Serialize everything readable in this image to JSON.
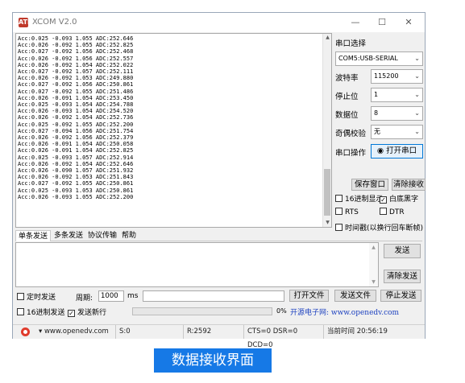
{
  "window": {
    "title": "XCOM V2.0",
    "app_icon": "ATK",
    "minimize": "—",
    "maximize": "☐",
    "close": "✕"
  },
  "receive": {
    "lines": [
      "Acc:0.025 -0.093 1.055 ADC:252.646",
      "Acc:0.026 -0.092 1.055 ADC:252.825",
      "Acc:0.027 -0.092 1.056 ADC:252.468",
      "Acc:0.026 -0.092 1.056 ADC:252.557",
      "Acc:0.026 -0.092 1.054 ADC:252.022",
      "Acc:0.027 -0.092 1.057 ADC:252.111",
      "Acc:0.026 -0.092 1.053 ADC:249.880",
      "Acc:0.027 -0.092 1.056 ADC:250.861",
      "Acc:0.027 -0.092 1.055 ADC:251.486",
      "Acc:0.026 -0.091 1.054 ADC:253.450",
      "Acc:0.025 -0.093 1.054 ADC:254.788",
      "Acc:0.026 -0.093 1.054 ADC:254.520",
      "Acc:0.026 -0.092 1.054 ADC:252.736",
      "Acc:0.025 -0.092 1.055 ADC:252.200",
      "Acc:0.027 -0.094 1.056 ADC:251.754",
      "Acc:0.026 -0.092 1.056 ADC:252.379",
      "Acc:0.026 -0.091 1.054 ADC:250.058",
      "Acc:0.026 -0.091 1.054 ADC:252.825",
      "Acc:0.025 -0.093 1.057 ADC:252.914",
      "Acc:0.026 -0.092 1.054 ADC:252.646",
      "Acc:0.026 -0.090 1.057 ADC:251.932",
      "Acc:0.026 -0.092 1.053 ADC:251.843",
      "Acc:0.027 -0.092 1.055 ADC:250.861",
      "Acc:0.025 -0.093 1.053 ADC:250.861",
      "Acc:0.026 -0.093 1.055 ADC:252.200"
    ],
    "scroll_up": "▲",
    "scroll_down": "▼"
  },
  "settings": {
    "port_label": "串口选择",
    "port_value": "COM5:USB-SERIAL",
    "baud_label": "波特率",
    "baud_value": "115200",
    "stop_label": "停止位",
    "stop_value": "1",
    "data_label": "数据位",
    "data_value": "8",
    "parity_label": "奇偶校验",
    "parity_value": "无",
    "op_label": "串口操作",
    "open_button": "打开串口",
    "save_window": "保存窗口",
    "clear_receive": "清除接收",
    "hex_display": "16进制显示",
    "white_bg": "白底黑字",
    "rts": "RTS",
    "dtr": "DTR",
    "timestamp": "时间戳(以换行回车断帧)"
  },
  "tabs": [
    "单条发送",
    "多条发送",
    "协议传输",
    "帮助"
  ],
  "send": {
    "send_button": "发送",
    "clear_send": "清除发送",
    "timed_send": "定时发送",
    "period_label": "周期:",
    "period_value": "1000",
    "period_unit": "ms",
    "open_file": "打开文件",
    "send_file": "发送文件",
    "stop_send": "停止发送",
    "hex_send": "16进制发送",
    "send_newline": "发送新行",
    "progress": "0%",
    "progress_fraction": 0,
    "website": "开源电子网: www.openedv.com"
  },
  "status": {
    "url": "www.openedv.com",
    "sent": "S:0",
    "received": "R:2592",
    "signals": "CTS=0 DSR=0 DCD=0",
    "time": "当前时间 20:56:19"
  },
  "caption": "数据接收界面"
}
